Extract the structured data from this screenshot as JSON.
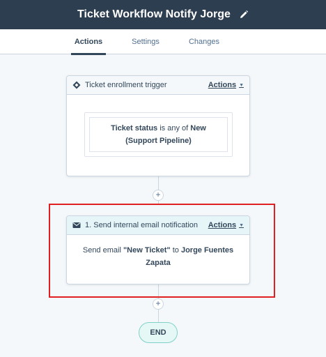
{
  "header": {
    "title": "Ticket Workflow Notify Jorge",
    "edit_icon": "pencil-icon"
  },
  "tabs": [
    {
      "label": "Actions",
      "active": true
    },
    {
      "label": "Settings",
      "active": false
    },
    {
      "label": "Changes",
      "active": false
    }
  ],
  "trigger_card": {
    "icon": "workflow-trigger-icon",
    "label": "Ticket enrollment trigger",
    "actions_label": "Actions",
    "filter": {
      "property": "Ticket status",
      "operator": " is any of ",
      "value": "New (Support Pipeline)"
    }
  },
  "action_card": {
    "icon": "envelope-icon",
    "label": "1. Send internal email notification",
    "actions_label": "Actions",
    "body": {
      "prefix": "Send email ",
      "email_name": "\"New Ticket\"",
      "connector": " to ",
      "recipient": "Jorge Fuentes Zapata"
    }
  },
  "add_button_label": "+",
  "end_label": "END",
  "colors": {
    "header_bg": "#2d3e50",
    "action_header_bg": "#e5f5f8",
    "highlight": "#e02020",
    "end_bg": "#e5f8f6"
  }
}
